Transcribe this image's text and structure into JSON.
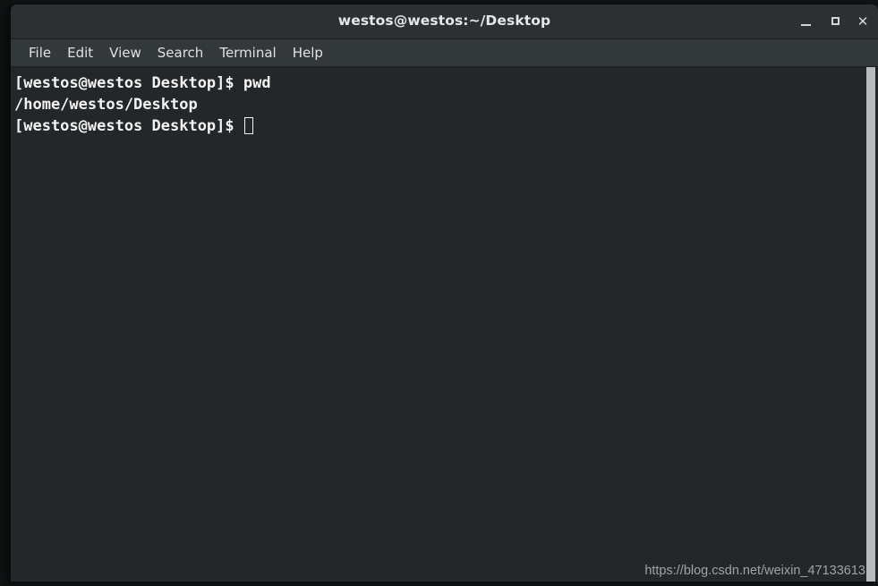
{
  "window": {
    "title": "westos@westos:~/Desktop",
    "controls": {
      "minimize_label": "_",
      "maximize_label": "□",
      "close_label": "✕"
    },
    "colors": {
      "titlebar_bg": "#2c3032",
      "menubar_bg": "#33383a",
      "terminal_bg": "#242729",
      "text_fg": "#f2f2f2",
      "scrollbar_thumb": "#b9bcbd"
    }
  },
  "menubar": {
    "items": [
      {
        "label": "File"
      },
      {
        "label": "Edit"
      },
      {
        "label": "View"
      },
      {
        "label": "Search"
      },
      {
        "label": "Terminal"
      },
      {
        "label": "Help"
      }
    ]
  },
  "terminal": {
    "lines": [
      {
        "text": "[westos@westos Desktop]$ pwd",
        "has_cursor": false
      },
      {
        "text": "/home/westos/Desktop",
        "has_cursor": false
      },
      {
        "text": "[westos@westos Desktop]$ ",
        "has_cursor": true
      }
    ],
    "prompt": "[westos@westos Desktop]$",
    "command": "pwd",
    "output": "/home/westos/Desktop"
  },
  "watermark": {
    "text": "https://blog.csdn.net/weixin_47133613"
  }
}
